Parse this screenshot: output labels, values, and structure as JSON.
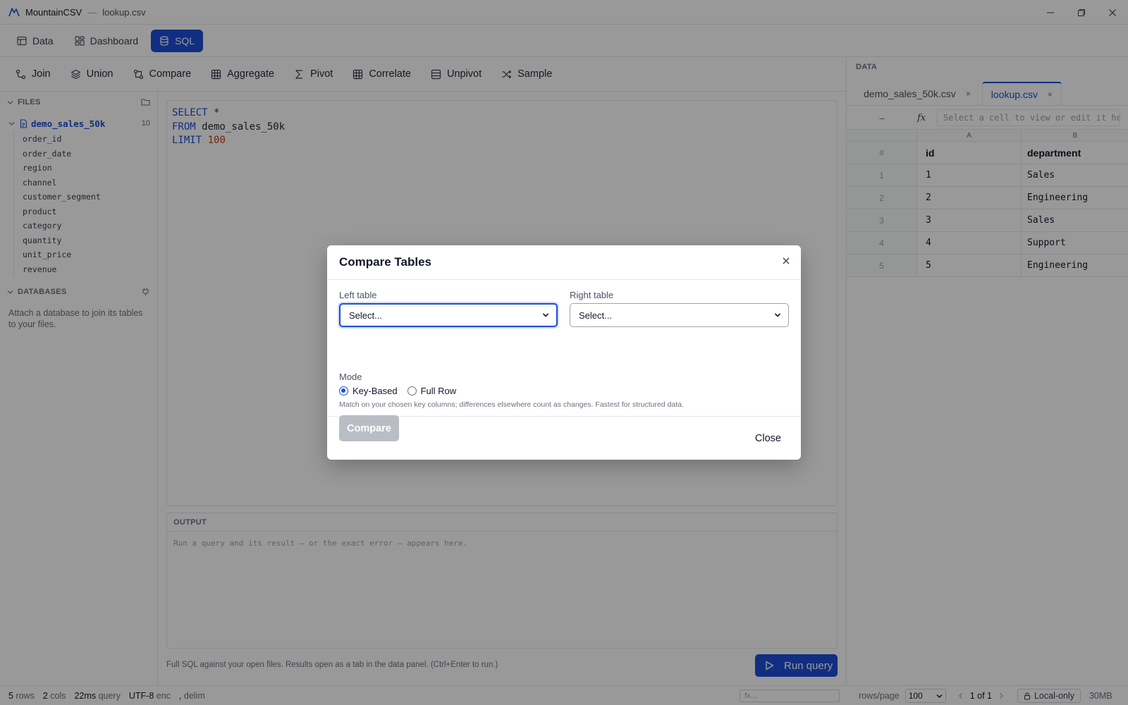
{
  "titlebar": {
    "app_name": "MountainCSV",
    "separator": "—",
    "file_name": "lookup.csv"
  },
  "top_tabs": [
    {
      "label": "Data",
      "icon": "table-icon"
    },
    {
      "label": "Dashboard",
      "icon": "dashboard-icon"
    },
    {
      "label": "SQL",
      "icon": "database-icon",
      "active": true
    }
  ],
  "toolbar": [
    {
      "label": "Join",
      "icon": "join-icon"
    },
    {
      "label": "Union",
      "icon": "layers-icon"
    },
    {
      "label": "Compare",
      "icon": "compare-icon"
    },
    {
      "label": "Aggregate",
      "icon": "grid-icon"
    },
    {
      "label": "Pivot",
      "icon": "sigma-icon"
    },
    {
      "label": "Correlate",
      "icon": "grid-icon"
    },
    {
      "label": "Unpivot",
      "icon": "rows-icon"
    },
    {
      "label": "Sample",
      "icon": "shuffle-icon"
    }
  ],
  "sidebar": {
    "files_heading": "FILES",
    "file": {
      "name": "demo_sales_50k",
      "count": "10"
    },
    "columns": [
      "order_id",
      "order_date",
      "region",
      "channel",
      "customer_segment",
      "product",
      "category",
      "quantity",
      "unit_price",
      "revenue"
    ],
    "databases_heading": "DATABASES",
    "databases_note": "Attach a database to join its tables to your files."
  },
  "editor": {
    "line1": {
      "kw": "SELECT",
      "rest": " *"
    },
    "line2": {
      "kw": "FROM",
      "rest": " demo_sales_50k"
    },
    "line3": {
      "kw": "LIMIT",
      "num": "100"
    }
  },
  "output": {
    "heading": "OUTPUT",
    "placeholder": "Run a query and its result — or the exact error — appears here."
  },
  "hint": "Full SQL against your open files. Results open as a tab in the data panel. (Ctrl+Enter to run.)",
  "run_button": "Run query",
  "data_panel": {
    "heading": "DATA",
    "tabs": [
      {
        "label": "demo_sales_50k.csv",
        "close": "×"
      },
      {
        "label": "lookup.csv",
        "close": "×",
        "active": true
      }
    ],
    "cell_ref": "–",
    "fx_symbol": "fx",
    "fx_placeholder": "Select a cell to view or edit it here",
    "col_letters": [
      "A",
      "B"
    ],
    "headers": [
      "#",
      "id",
      "department"
    ],
    "rows": [
      [
        "1",
        "1",
        "Sales"
      ],
      [
        "2",
        "2",
        "Engineering"
      ],
      [
        "3",
        "3",
        "Sales"
      ],
      [
        "4",
        "4",
        "Support"
      ],
      [
        "5",
        "5",
        "Engineering"
      ]
    ]
  },
  "statusbar": {
    "rows_val": "5",
    "rows_lbl": "rows",
    "cols_val": "2",
    "cols_lbl": "cols",
    "query_val": "22ms",
    "query_lbl": "query",
    "enc_val": "UTF-8",
    "enc_lbl": "enc",
    "delim_val": ",",
    "delim_lbl": "delim",
    "fx_placeholder": "fx...",
    "rows_per_page_label": "rows/page",
    "rows_per_page_value": "100",
    "page_info": "1 of 1",
    "mode_badge": "Local-only",
    "memory": "30MB"
  },
  "modal": {
    "title": "Compare Tables",
    "left_label": "Left table",
    "left_value": "Select...",
    "right_label": "Right table",
    "right_value": "Select...",
    "mode_label": "Mode",
    "mode_options": [
      "Key-Based",
      "Full Row"
    ],
    "mode_selected": "Key-Based",
    "mode_help": "Match on your chosen key columns; differences elsewhere count as changes. Fastest for structured data.",
    "compare_button": "Compare",
    "close_button": "Close"
  },
  "colors": {
    "accent": "#1d4ed8",
    "disabled_button": "#b9bdc4",
    "sql_number": "#c2410c"
  }
}
